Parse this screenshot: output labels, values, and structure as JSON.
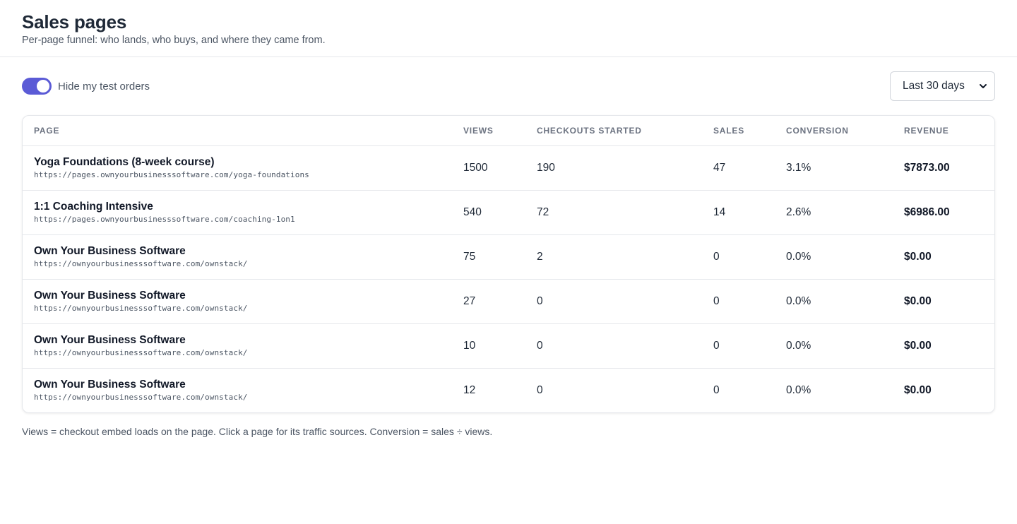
{
  "header": {
    "title": "Sales pages",
    "subtitle": "Per-page funnel: who lands, who buys, and where they came from."
  },
  "controls": {
    "toggle_label": "Hide my test orders",
    "toggle_on": true,
    "range_selected": "Last 30 days"
  },
  "table": {
    "columns": [
      "PAGE",
      "VIEWS",
      "CHECKOUTS STARTED",
      "SALES",
      "CONVERSION",
      "REVENUE"
    ],
    "rows": [
      {
        "title": "Yoga Foundations (8-week course)",
        "url": "https://pages.ownyourbusinesssoftware.com/yoga-foundations",
        "views": "1500",
        "checkouts": "190",
        "sales": "47",
        "conversion": "3.1%",
        "revenue": "$7873.00"
      },
      {
        "title": "1:1 Coaching Intensive",
        "url": "https://pages.ownyourbusinesssoftware.com/coaching-1on1",
        "views": "540",
        "checkouts": "72",
        "sales": "14",
        "conversion": "2.6%",
        "revenue": "$6986.00"
      },
      {
        "title": "Own Your Business Software",
        "url": "https://ownyourbusinesssoftware.com/ownstack/",
        "views": "75",
        "checkouts": "2",
        "sales": "0",
        "conversion": "0.0%",
        "revenue": "$0.00"
      },
      {
        "title": "Own Your Business Software",
        "url": "https://ownyourbusinesssoftware.com/ownstack/",
        "views": "27",
        "checkouts": "0",
        "sales": "0",
        "conversion": "0.0%",
        "revenue": "$0.00"
      },
      {
        "title": "Own Your Business Software",
        "url": "https://ownyourbusinesssoftware.com/ownstack/",
        "views": "10",
        "checkouts": "0",
        "sales": "0",
        "conversion": "0.0%",
        "revenue": "$0.00"
      },
      {
        "title": "Own Your Business Software",
        "url": "https://ownyourbusinesssoftware.com/ownstack/",
        "views": "12",
        "checkouts": "0",
        "sales": "0",
        "conversion": "0.0%",
        "revenue": "$0.00"
      }
    ]
  },
  "footnote": "Views = checkout embed loads on the page. Click a page for its traffic sources. Conversion = sales ÷ views.",
  "colors": {
    "accent": "#5b5bd6",
    "text": "#1f2937",
    "muted": "#4b5563",
    "border": "#e5e7eb"
  },
  "icons": {
    "range_select": "chevron-down-icon"
  }
}
